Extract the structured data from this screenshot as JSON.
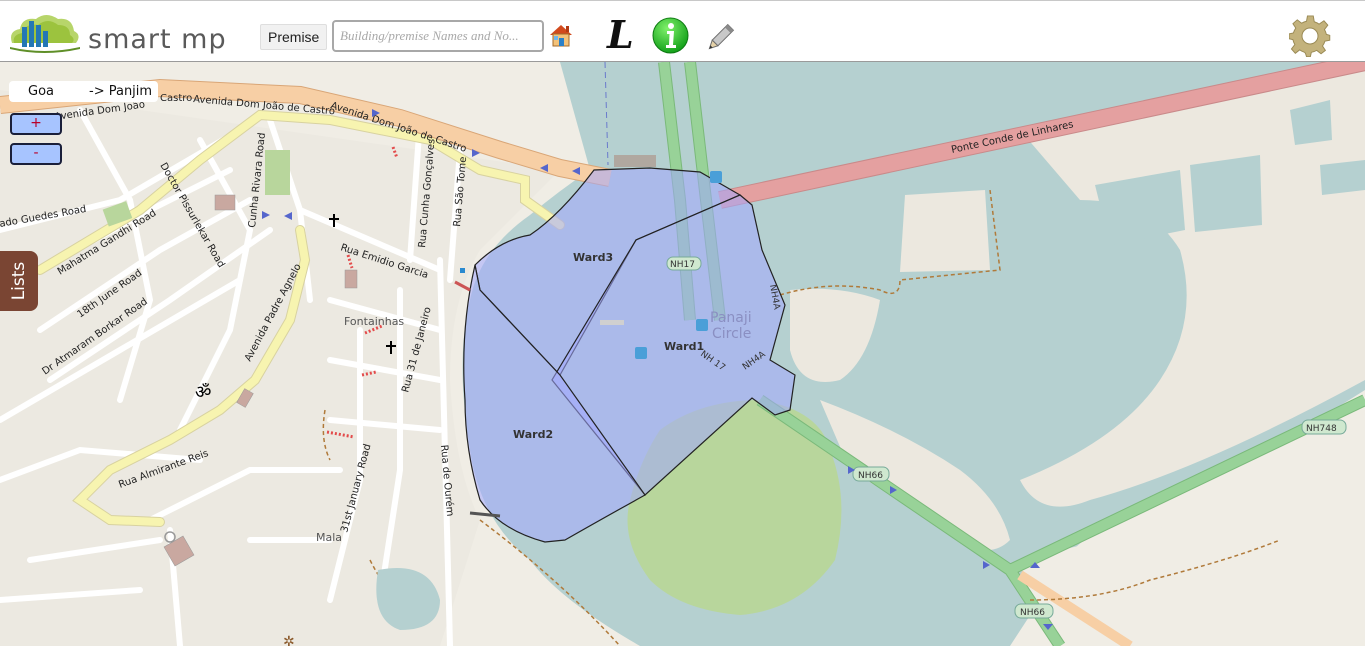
{
  "header": {
    "logo_text": "smart mp",
    "premise_button": "Premise",
    "search_placeholder": "Building/premise Names and No..."
  },
  "breadcrumb": {
    "items": [
      "Goa",
      "-> Panjim"
    ]
  },
  "zoom": {
    "in_label": "+",
    "out_label": "-"
  },
  "side_tab": {
    "label": "Lists"
  },
  "map": {
    "wards": [
      "Ward1",
      "Ward2",
      "Ward3"
    ],
    "streets": [
      "Avenida Dom João de Castro",
      "Avenida Dom João de Castro",
      "Avenida Dom João de Castro",
      "Castro",
      "Ponte Conde de Linhares",
      "Doctor Pissurlekar Road",
      "Cunha Rivara Road",
      "Rua Cunha Gonçalves",
      "Rua São Tome",
      "Mahatma Gandhi Road",
      "Rua Emidio Garcia",
      "18th June Road",
      "Dr Atmaram Borkar Road",
      "Avenida Padre Agnelo",
      "Rua 31 de Janeiro",
      "Rua Almirante Reis",
      "31st January Road",
      "Rua de Ourém",
      "ado Guedes Road"
    ],
    "places": [
      "Fontainhas",
      "Mala",
      "Panaji Circle"
    ],
    "shields": [
      "NH17",
      "NH4A",
      "NH 17",
      "NH66",
      "NH748",
      "NH66",
      "NH4A"
    ]
  },
  "colors": {
    "water": "#b5d0d0",
    "land": "#f0ede5",
    "primary_road": "#f7cfa5",
    "secondary_road": "#f7f4b0",
    "trunk_road": "#98d298",
    "bridge_road": "#e4a0a0",
    "ward_fill": "#a3a8ff",
    "ward_border": "#222222",
    "park": "#b8d69c",
    "zoom_button": "#a7c4ff",
    "lists_tab": "#7a4533"
  },
  "icons": [
    "logo-icon",
    "home-icon",
    "l-icon",
    "info-icon",
    "pencil-icon",
    "gear-icon"
  ]
}
